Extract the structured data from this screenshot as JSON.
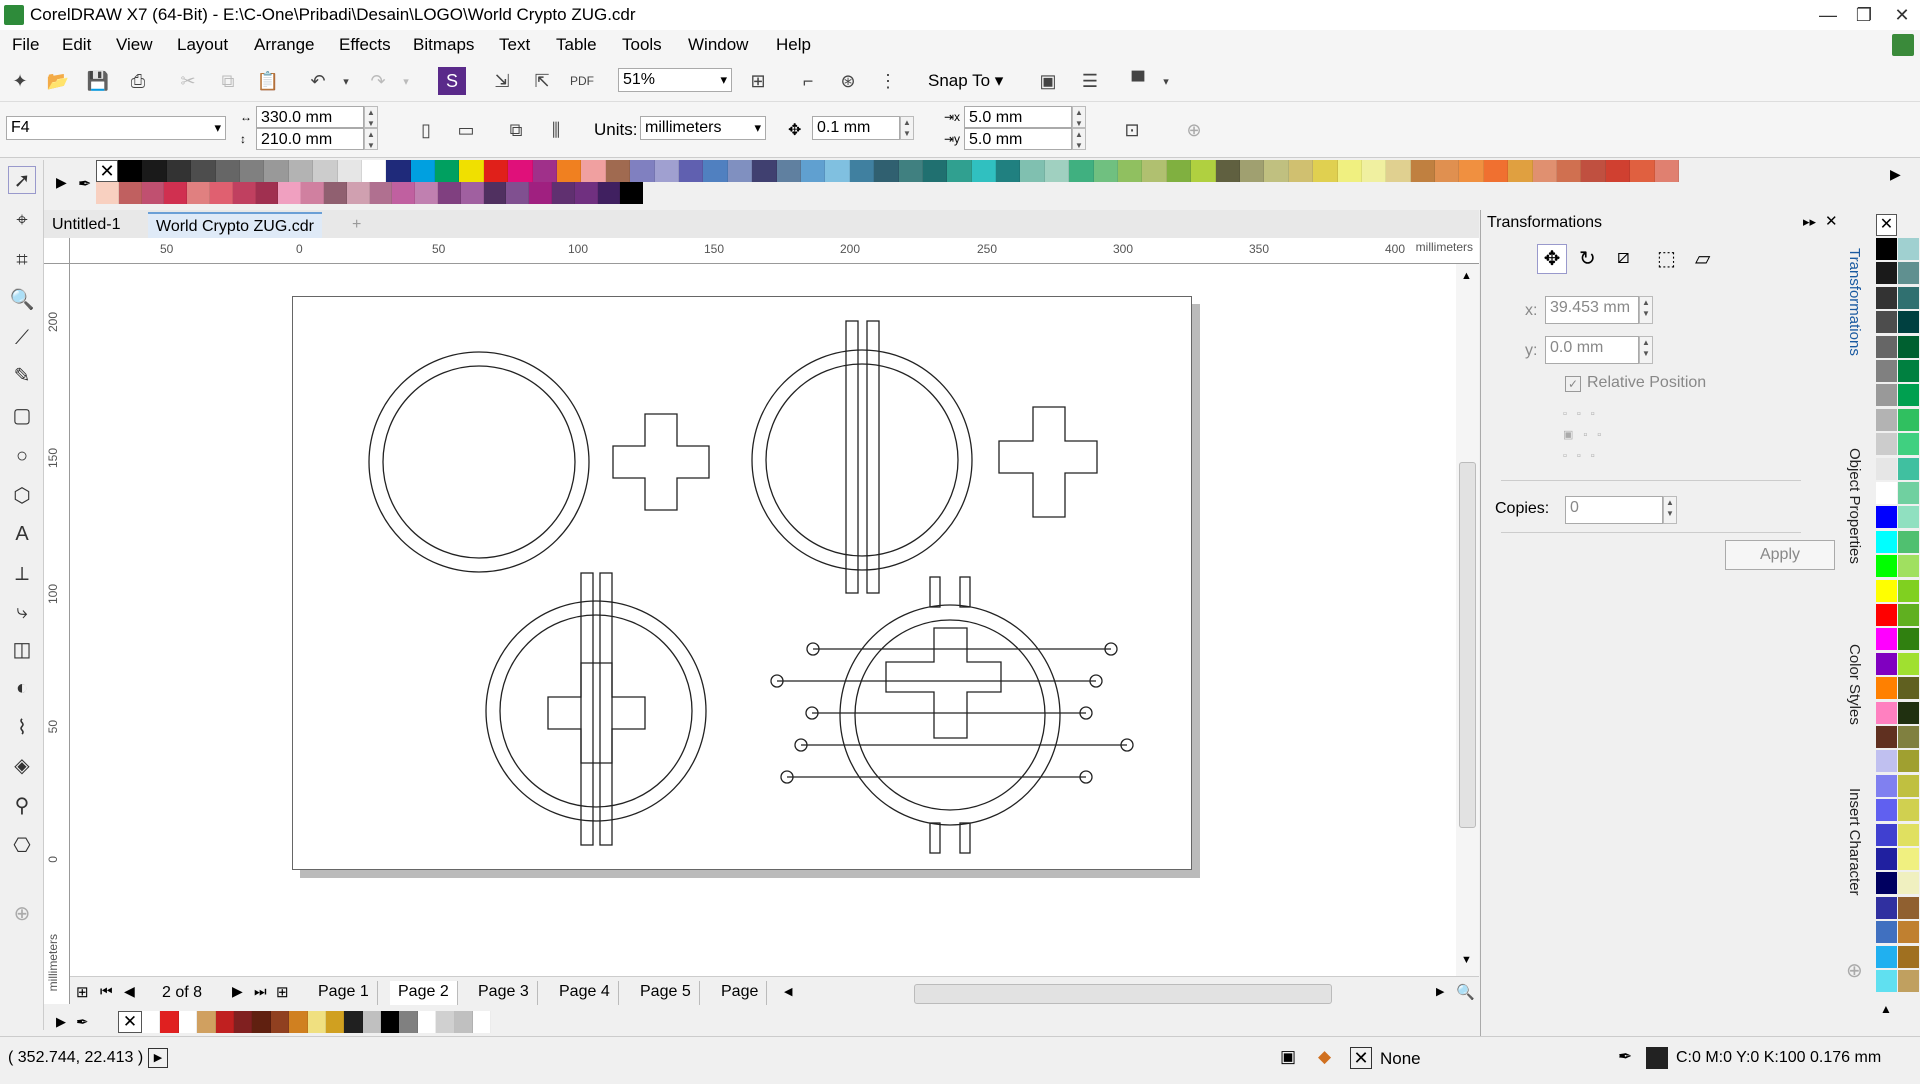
{
  "window": {
    "title": "CorelDRAW X7 (64-Bit) - E:\\C-One\\Pribadi\\Desain\\LOGO\\World Crypto ZUG.cdr",
    "min": "—",
    "max": "❐",
    "close": "✕"
  },
  "menu": [
    "File",
    "Edit",
    "View",
    "Layout",
    "Arrange",
    "Effects",
    "Bitmaps",
    "Text",
    "Table",
    "Tools",
    "Window",
    "Help"
  ],
  "toolbar": {
    "zoom": "51%",
    "snap_to": "Snap To"
  },
  "property_bar": {
    "page_size": "F4",
    "width": "330.0 mm",
    "height": "210.0 mm",
    "units_label": "Units:",
    "units": "millimeters",
    "nudge": "0.1 mm",
    "dup_x": "5.0 mm",
    "dup_y": "5.0 mm"
  },
  "palette_top": [
    "#000000",
    "#1a1a1a",
    "#333333",
    "#4d4d4d",
    "#666666",
    "#808080",
    "#999999",
    "#b3b3b3",
    "#cccccc",
    "#e6e6e6",
    "#ffffff",
    "#1f2a7a",
    "#00a0e0",
    "#00a060",
    "#f0e000",
    "#e0201a",
    "#e0107a",
    "#a0308a",
    "#f08020",
    "#f0a0a0",
    "#a06a50",
    "#8080c0",
    "#a0a0d0",
    "#6060b0",
    "#5080c0",
    "#8090c0",
    "#404070",
    "#6080a0",
    "#60a0d0",
    "#80c0e0",
    "#4080a0",
    "#306070",
    "#408080",
    "#207070",
    "#30a090",
    "#30c0c0",
    "#208080",
    "#80c0b0",
    "#a0d0c0",
    "#40b080",
    "#70c080",
    "#90c060",
    "#b0c070",
    "#80b040",
    "#b0d040",
    "#606040",
    "#a0a070",
    "#c0c080",
    "#d0c070",
    "#e0d050",
    "#f0f080",
    "#f0f0a0",
    "#e0d090",
    "#c08040",
    "#e09050",
    "#f09040",
    "#f07030",
    "#e0a040",
    "#e09070",
    "#d07050",
    "#c05040",
    "#d04030",
    "#e06040",
    "#e08070"
  ],
  "palette_top2": [
    "#f8d0c0",
    "#c06060",
    "#c05070",
    "#d03050",
    "#e08080",
    "#e06070",
    "#c04060",
    "#a03050",
    "#f0a0c0",
    "#d080a0",
    "#906070",
    "#d0a0b0",
    "#b07090",
    "#c060a0",
    "#c080b0",
    "#804080",
    "#a060a0",
    "#503060",
    "#805090",
    "#a02080",
    "#603070",
    "#703080",
    "#402060",
    "#000000"
  ],
  "tabs": {
    "untitled": "Untitled-1",
    "doc": "World Crypto ZUG.cdr"
  },
  "ruler": {
    "unit": "millimeters",
    "h_ticks": [
      "50",
      "0",
      "50",
      "100",
      "150",
      "200",
      "250",
      "300",
      "350",
      "400"
    ],
    "v_ticks": [
      "200",
      "150",
      "100",
      "50",
      "0"
    ]
  },
  "pages": {
    "counter": "2 of 8",
    "tabs": [
      "Page 1",
      "Page 2",
      "Page 3",
      "Page 4",
      "Page 5",
      "Page"
    ]
  },
  "doc_palette": [
    "#ffffff",
    "#e02020",
    "#ffffff",
    "#d0a060",
    "#c02020",
    "#802020",
    "#602010",
    "#904020",
    "#d08020",
    "#f0e080",
    "#d0a020",
    "#202020",
    "#c0c0c0",
    "#000000",
    "#808080",
    "#ffffff",
    "#d0d0d0",
    "#c0c0c0",
    "#ffffff"
  ],
  "transform": {
    "title": "Transformations",
    "x_label": "x:",
    "x": "39.453 mm",
    "y_label": "y:",
    "y": "0.0 mm",
    "relative": "Relative Position",
    "copies_label": "Copies:",
    "copies": "0",
    "apply": "Apply"
  },
  "docker_tabs": [
    "Transformations",
    "Object Properties",
    "Color Styles",
    "Insert Character"
  ],
  "status": {
    "coords": "( 352.744, 22.413 )",
    "fill": "None",
    "outline": "C:0 M:0 Y:0 K:100  0.176 mm"
  },
  "right_palette": [
    "#000000",
    "#a0d0d0",
    "#1a1a1a",
    "#609090",
    "#333333",
    "#307070",
    "#4d4d4d",
    "#004040",
    "#666666",
    "#006030",
    "#808080",
    "#008040",
    "#999999",
    "#00a050",
    "#b3b3b3",
    "#30c060",
    "#cccccc",
    "#40d080",
    "#e6e6e6",
    "#40c0a0",
    "#ffffff",
    "#70d0a0",
    "#0000ff",
    "#90e0c0",
    "#00ffff",
    "#50c070",
    "#00ff00",
    "#a0e060",
    "#ffff00",
    "#80d020",
    "#ff0000",
    "#60b020",
    "#ff00ff",
    "#308010",
    "#8000c0",
    "#a0e030",
    "#ff8000",
    "#606020",
    "#ff80c0",
    "#203010",
    "#603020",
    "#808040",
    "#c0c0f0",
    "#a0a030",
    "#8080f0",
    "#c0c040",
    "#6060f0",
    "#d0d050",
    "#4040d0",
    "#e0e060",
    "#2020a0",
    "#f0f080",
    "#000060",
    "#f0f0c0",
    "#3030a0",
    "#906030",
    "#4070c0",
    "#c08030",
    "#20b0f0",
    "#a07020",
    "#60e0f0",
    "#c0a060"
  ]
}
